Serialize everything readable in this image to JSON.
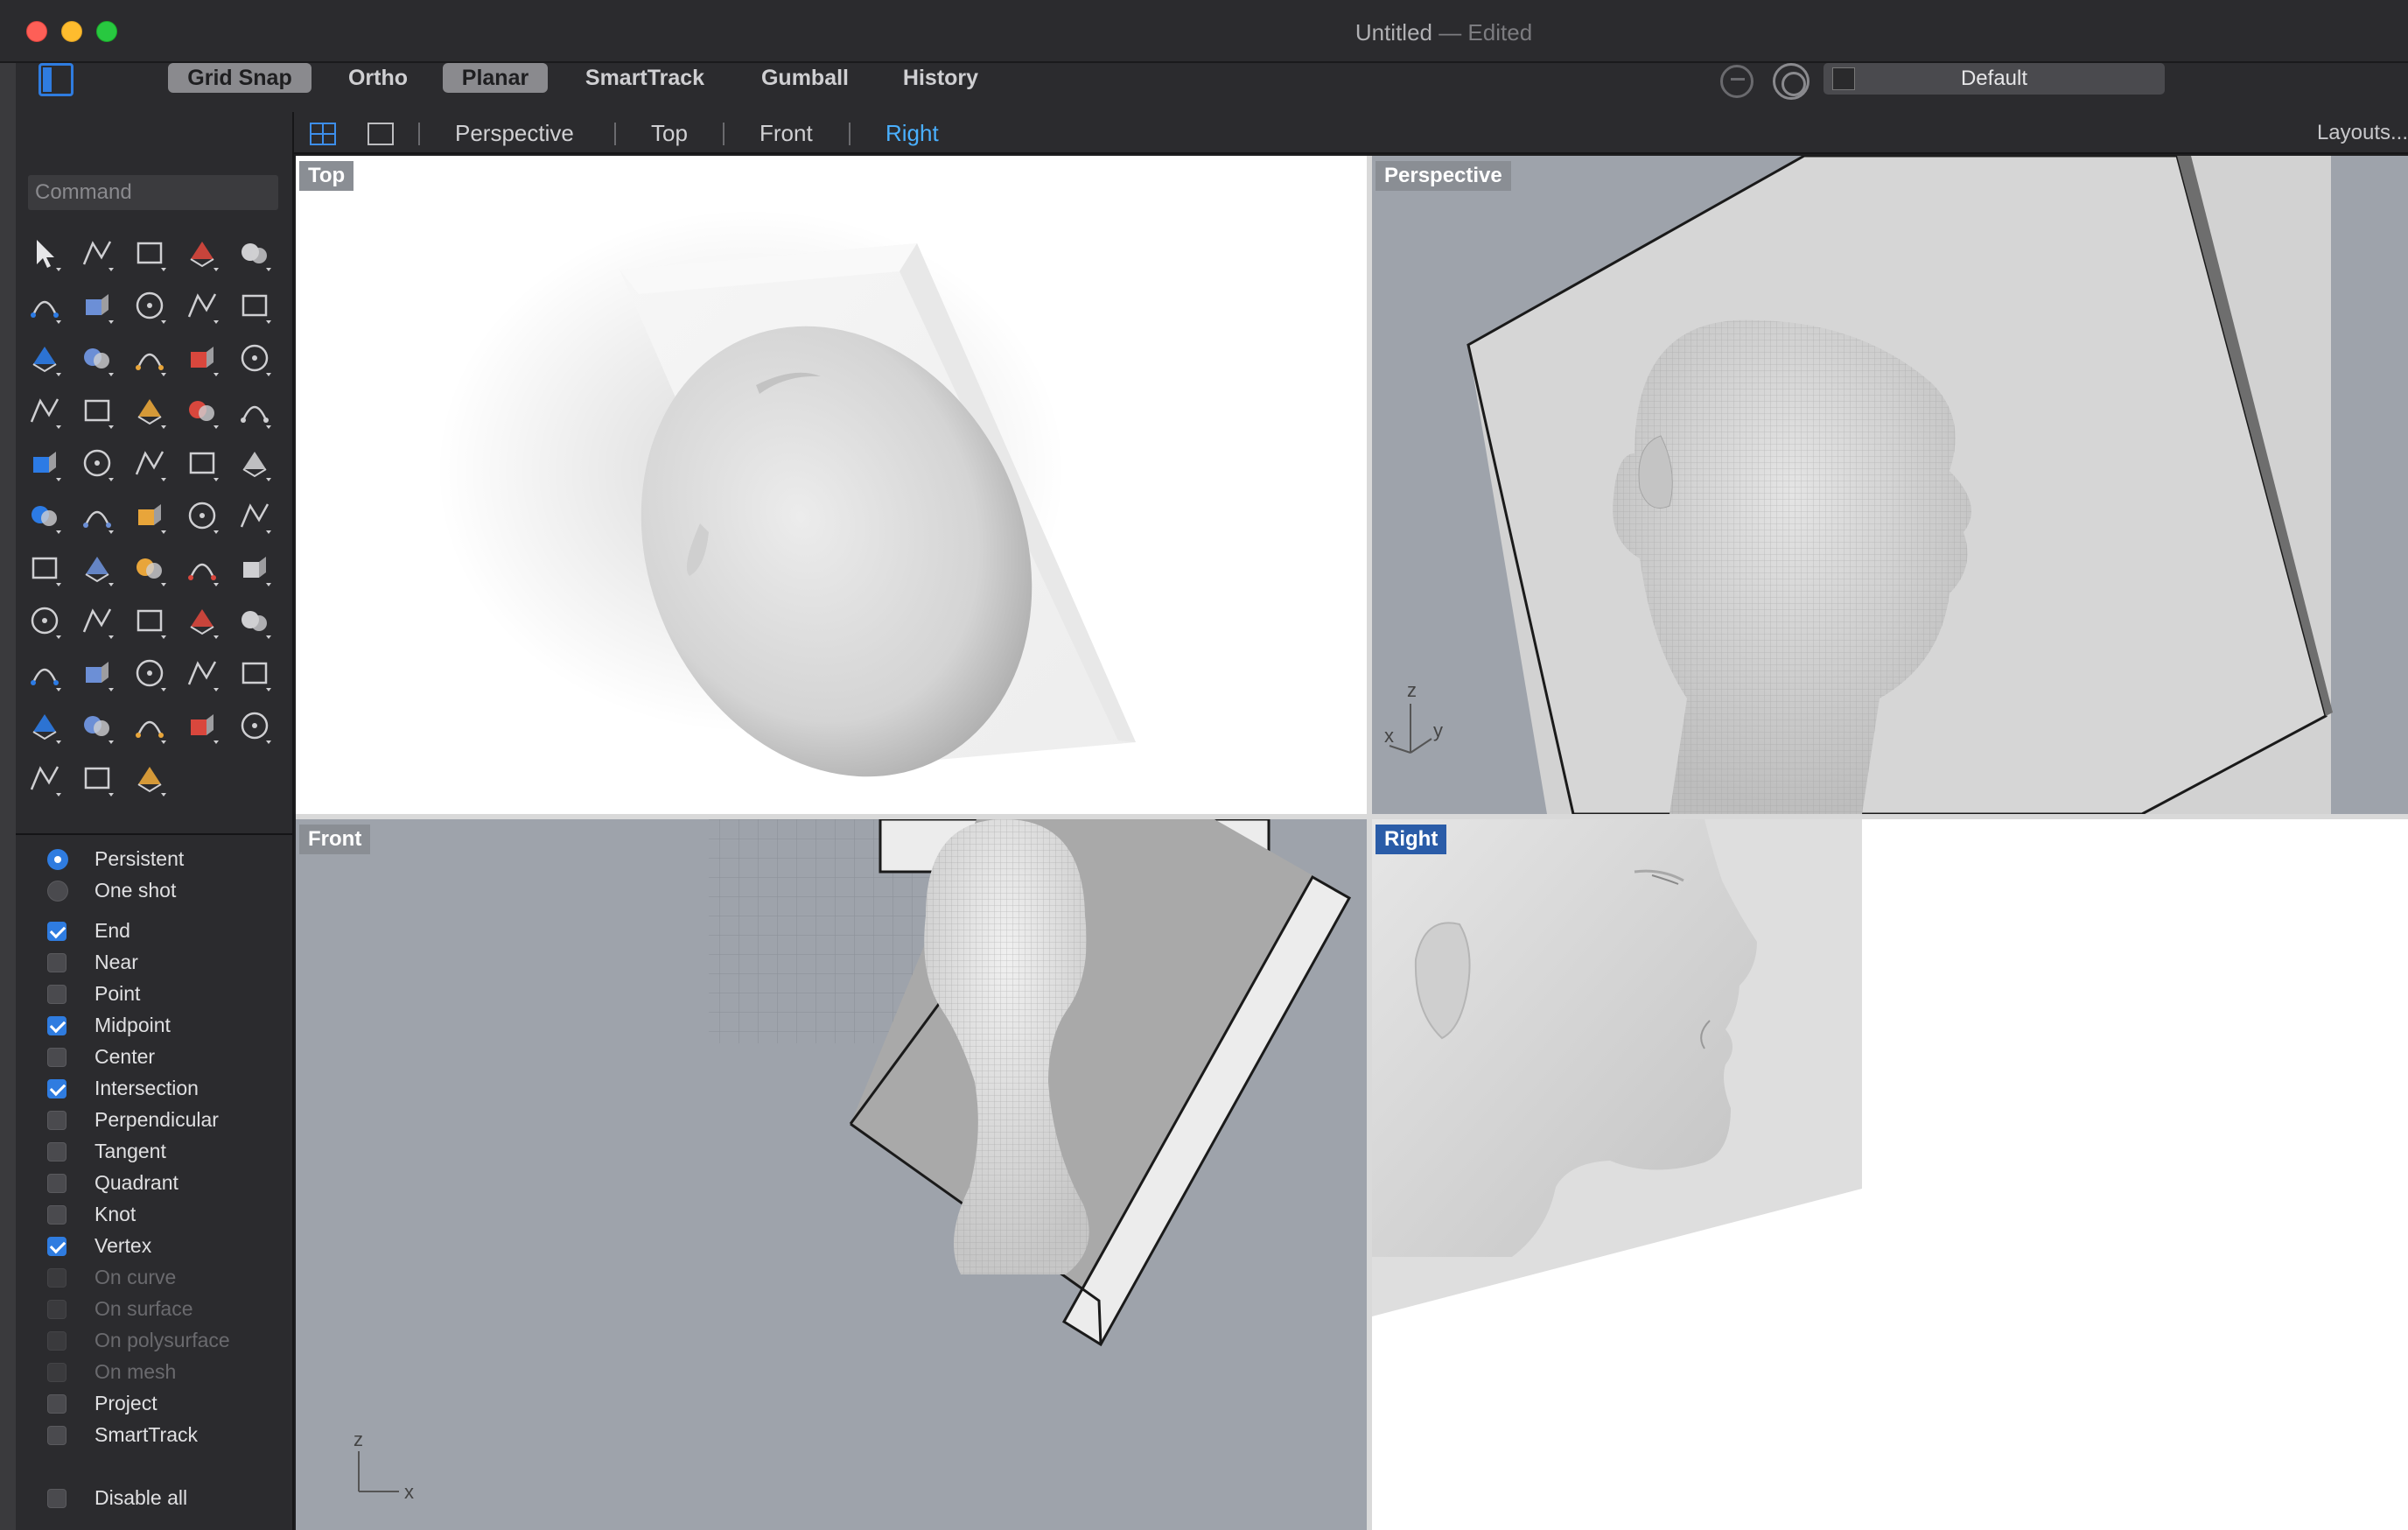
{
  "window": {
    "title": "Untitled",
    "title_suffix": " — Edited"
  },
  "toolbar": {
    "grid_snap": "Grid Snap",
    "ortho": "Ortho",
    "planar": "Planar",
    "smarttrack": "SmartTrack",
    "gumball": "Gumball",
    "history": "History",
    "active_toggles": [
      "Grid Snap",
      "Planar"
    ],
    "layer": "Default"
  },
  "viewport_tabs": {
    "tabs": [
      {
        "label": "Perspective",
        "active": false
      },
      {
        "label": "Top",
        "active": false
      },
      {
        "label": "Front",
        "active": false
      },
      {
        "label": "Right",
        "active": true
      }
    ],
    "layouts": "Layouts..."
  },
  "command": {
    "placeholder": "Command"
  },
  "tools": [
    "select-arrow-icon",
    "point-icon",
    "polyline-icon",
    "curve-icon",
    "circle-icon",
    "ellipse-icon",
    "arc-icon",
    "rectangle-icon",
    "polygon-icon",
    "fillet-curve-icon",
    "surface-icon",
    "extrude-surface-icon",
    "box-solid-icon",
    "sphere-boolean-icon",
    "cylinder-icon",
    "plane-icon",
    "explode-icon",
    "split-icon",
    "offset-icon",
    "trim-icon",
    "boolean-icon",
    "group-icon",
    "rotate-curve-icon",
    "blend-icon",
    "text-icon",
    "scale-icon",
    "array-icon",
    "cut-icon",
    "box-edit-icon",
    "dimension-icon",
    "grid-array-icon",
    "split-solid-icon",
    "extract-icon",
    "check-icon",
    "mesh-icon",
    "paint-icon",
    "zoom-icon",
    "zoom-window-icon",
    "zoom-extents-icon",
    "zoom-selected-icon",
    "rotate-view-icon",
    "car-model-icon",
    "grid-plane-icon",
    "points-icon",
    "light-icon",
    "lock-icon",
    "material-icon",
    "color-wheel-icon",
    "render-sphere-icon",
    "display-sphere-icon",
    "globe-icon",
    "camera-icon",
    "history-tree-icon"
  ],
  "osnap": {
    "mode": [
      {
        "label": "Persistent",
        "checked": true
      },
      {
        "label": "One shot",
        "checked": false
      }
    ],
    "items": [
      {
        "label": "End",
        "checked": true,
        "enabled": true
      },
      {
        "label": "Near",
        "checked": false,
        "enabled": true
      },
      {
        "label": "Point",
        "checked": false,
        "enabled": true
      },
      {
        "label": "Midpoint",
        "checked": true,
        "enabled": true
      },
      {
        "label": "Center",
        "checked": false,
        "enabled": true
      },
      {
        "label": "Intersection",
        "checked": true,
        "enabled": true
      },
      {
        "label": "Perpendicular",
        "checked": false,
        "enabled": true
      },
      {
        "label": "Tangent",
        "checked": false,
        "enabled": true
      },
      {
        "label": "Quadrant",
        "checked": false,
        "enabled": true
      },
      {
        "label": "Knot",
        "checked": false,
        "enabled": true
      },
      {
        "label": "Vertex",
        "checked": true,
        "enabled": true
      },
      {
        "label": "On curve",
        "checked": false,
        "enabled": false
      },
      {
        "label": "On surface",
        "checked": false,
        "enabled": false
      },
      {
        "label": "On polysurface",
        "checked": false,
        "enabled": false
      },
      {
        "label": "On mesh",
        "checked": false,
        "enabled": false
      },
      {
        "label": "Project",
        "checked": false,
        "enabled": true
      },
      {
        "label": "SmartTrack",
        "checked": false,
        "enabled": true
      }
    ],
    "disable_all": "Disable all"
  },
  "viewports": {
    "top": {
      "label": "Top"
    },
    "perspective": {
      "label": "Perspective",
      "axes": {
        "x": "x",
        "y": "y",
        "z": "z"
      }
    },
    "front": {
      "label": "Front",
      "axes": {
        "x": "x",
        "z": "z"
      }
    },
    "right": {
      "label": "Right",
      "active": true
    }
  },
  "colors": {
    "accent": "#2f7ce0",
    "active_tab": "#4ab0ff",
    "viewport_bg": "#9ea3ab",
    "viewport_white": "#ffffff"
  }
}
